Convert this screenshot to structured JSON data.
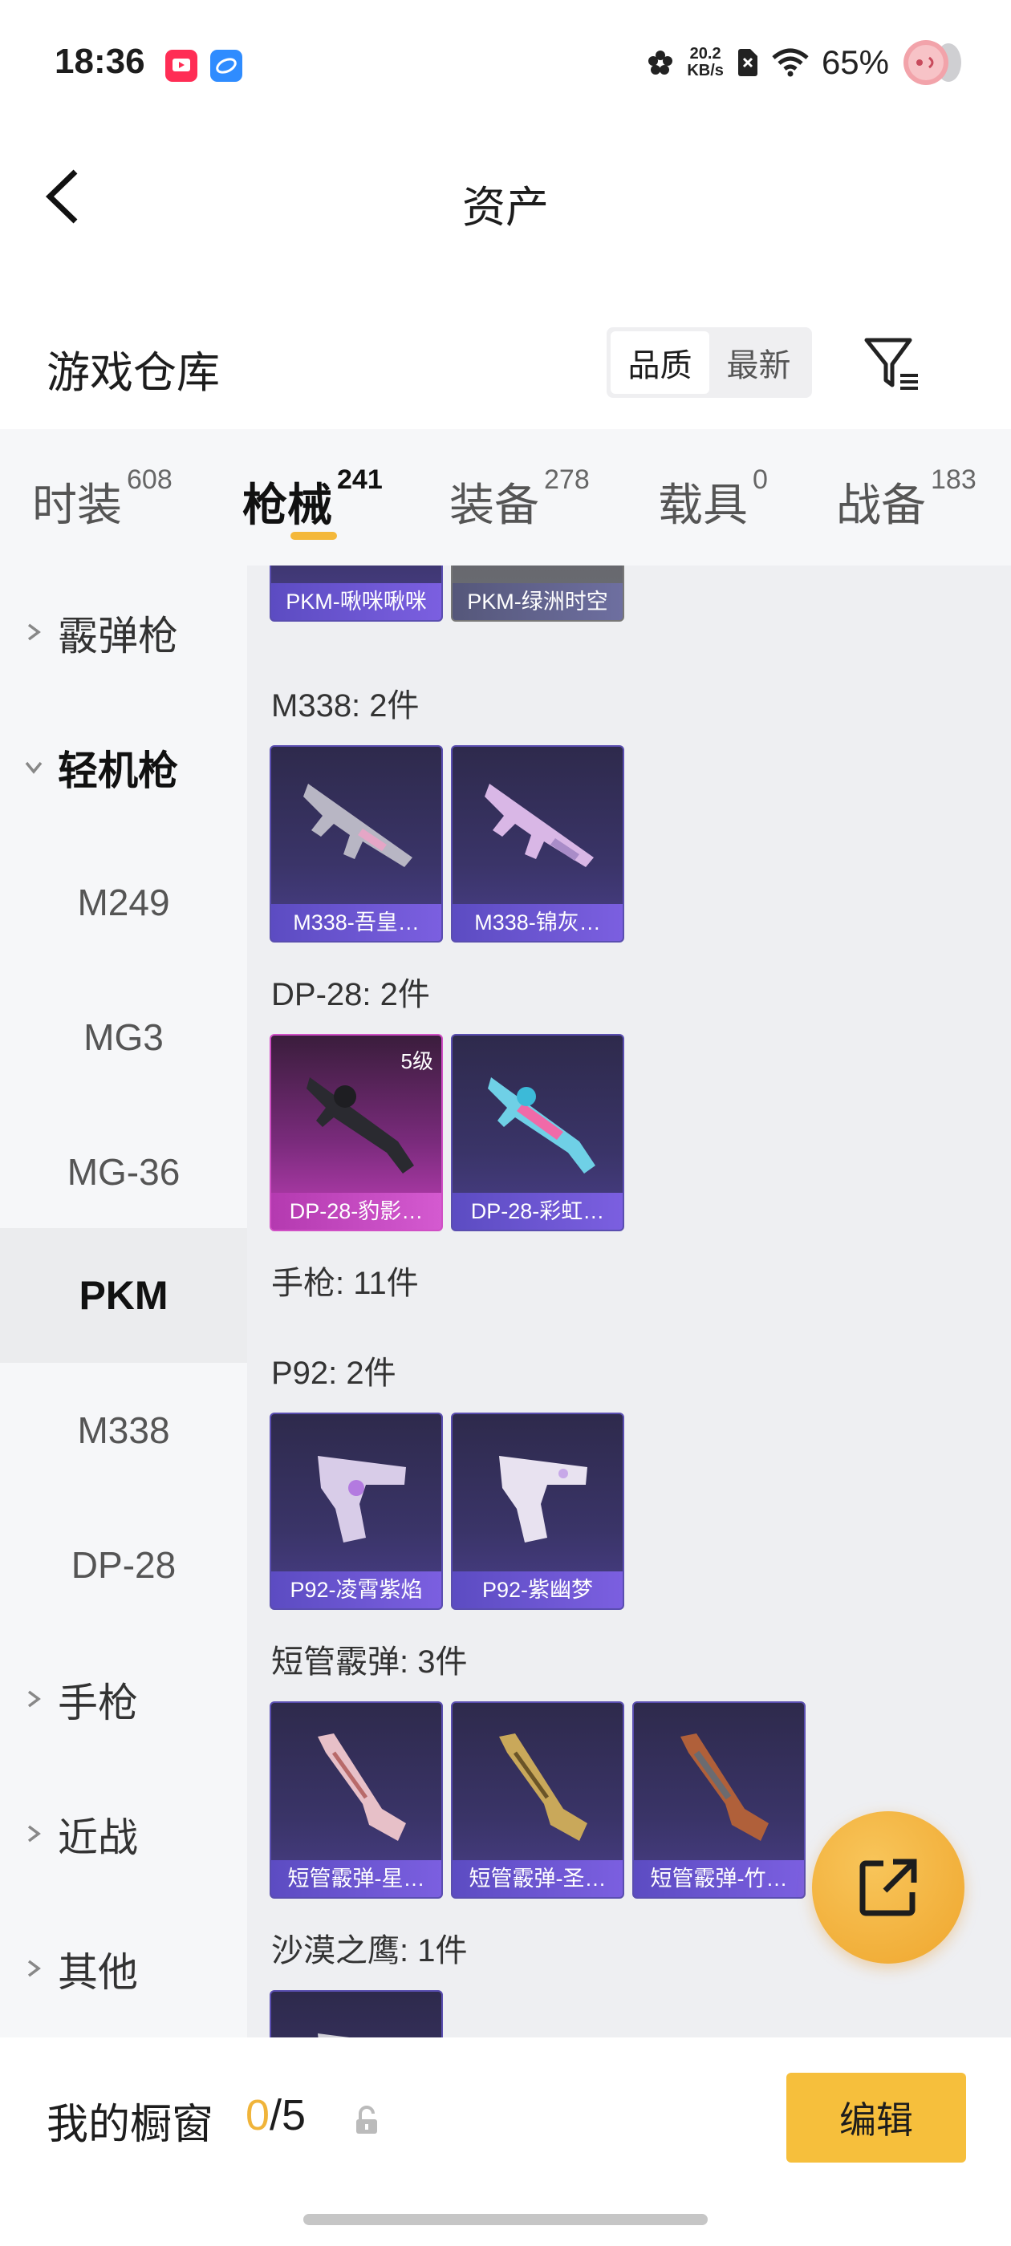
{
  "status_bar": {
    "time": "18:36",
    "speed_value": "20.2",
    "speed_unit": "KB/s",
    "battery": "65%"
  },
  "header": {
    "title": "资产"
  },
  "warehouse": {
    "title": "游戏仓库",
    "sort_options": [
      "品质",
      "最新"
    ],
    "active_sort": "品质"
  },
  "category_tabs": [
    {
      "label": "时装",
      "count": "608"
    },
    {
      "label": "枪械",
      "count": "241",
      "active": true
    },
    {
      "label": "装备",
      "count": "278"
    },
    {
      "label": "载具",
      "count": "0"
    },
    {
      "label": "战备",
      "count": "183"
    }
  ],
  "sidebar": {
    "items": [
      {
        "label": "霰弹枪",
        "type": "group"
      },
      {
        "label": "轻机枪",
        "type": "group",
        "open": true
      },
      {
        "label": "M249",
        "type": "sub"
      },
      {
        "label": "MG3",
        "type": "sub"
      },
      {
        "label": "MG-36",
        "type": "sub"
      },
      {
        "label": "PKM",
        "type": "sub",
        "active": true
      },
      {
        "label": "M338",
        "type": "sub"
      },
      {
        "label": "DP-28",
        "type": "sub"
      },
      {
        "label": "手枪",
        "type": "group"
      },
      {
        "label": "近战",
        "type": "group"
      },
      {
        "label": "其他",
        "type": "group"
      }
    ]
  },
  "content": {
    "sections": [
      {
        "title": "",
        "cards": [
          {
            "name": "PKM-啾咪啾咪",
            "style": "purple"
          },
          {
            "name": "PKM-绿洲时空",
            "style": "gray"
          }
        ]
      },
      {
        "title": "M338: 2件",
        "cards": [
          {
            "name": "M338-吾皇…",
            "style": "purple"
          },
          {
            "name": "M338-锦灰…",
            "style": "purple"
          }
        ]
      },
      {
        "title": "DP-28: 2件",
        "cards": [
          {
            "name": "DP-28-豹影…",
            "style": "pink",
            "level": "5级"
          },
          {
            "name": "DP-28-彩虹…",
            "style": "purple"
          }
        ]
      },
      {
        "title": "手枪: 11件",
        "cards": []
      },
      {
        "title": "P92: 2件",
        "cards": [
          {
            "name": "P92-凌霄紫焰",
            "style": "purple"
          },
          {
            "name": "P92-紫幽梦",
            "style": "purple"
          }
        ]
      },
      {
        "title": "短管霰弹: 3件",
        "cards": [
          {
            "name": "短管霰弹-星…",
            "style": "purple"
          },
          {
            "name": "短管霰弹-圣…",
            "style": "purple"
          },
          {
            "name": "短管霰弹-竹…",
            "style": "purple"
          }
        ]
      },
      {
        "title": "沙漠之鹰: 1件",
        "cards": [
          {
            "name": "",
            "style": "purple"
          }
        ]
      }
    ]
  },
  "showcase": {
    "title": "我的橱窗",
    "current": "0",
    "separator_max": "/5",
    "edit_label": "编辑"
  },
  "colors": {
    "accent": "#f6bf3c",
    "card_purple": "#3a3468",
    "card_pink": "#c03fb8"
  }
}
